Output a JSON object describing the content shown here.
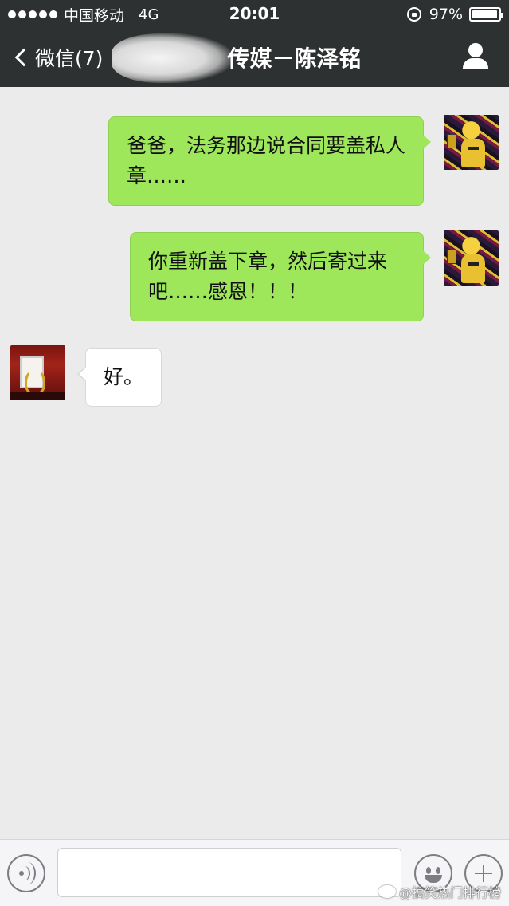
{
  "status_bar": {
    "carrier": "中国移动",
    "network": "4G",
    "time": "20:01",
    "battery_percent_text": "97%",
    "battery_level": 0.97
  },
  "nav": {
    "back_label": "微信(7)",
    "title": "传媒－陈泽铭"
  },
  "messages": [
    {
      "direction": "outgoing",
      "text": "爸爸，法务那边说合同要盖私人章……"
    },
    {
      "direction": "outgoing",
      "text": "你重新盖下章，然后寄过来吧……感恩！！！"
    },
    {
      "direction": "incoming",
      "text": "好。"
    }
  ],
  "input_bar": {
    "input_value": "",
    "voice_icon": "voice-icon",
    "emoji_icon": "emoji-icon",
    "plus_icon": "plus-icon"
  },
  "watermark": "@搞笑热门排行榜",
  "colors": {
    "header_bg": "#2e3132",
    "chat_bg": "#ebebeb",
    "outgoing_bubble": "#9ee65a",
    "incoming_bubble": "#ffffff"
  }
}
